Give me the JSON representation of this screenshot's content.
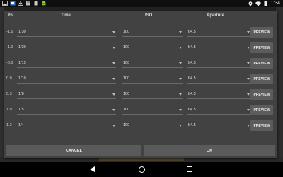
{
  "status_bar": {
    "time": "1:34",
    "left_icons": [
      "image-icon",
      "gallery-icon",
      "download-icon",
      "storage-icon",
      "sd-card-icon",
      "android-icon"
    ],
    "right_icons": [
      "location-icon",
      "wifi-icon",
      "battery-icon"
    ]
  },
  "dialog": {
    "headers": {
      "ev": "Ev",
      "time": "Time",
      "iso": "ISO",
      "aperture": "Aperture"
    },
    "rows": [
      {
        "ev": "-1.6",
        "time": "1/30",
        "iso": "100",
        "aperture": "f/4.5",
        "preview": "PREVIEW"
      },
      {
        "ev": "-1.0",
        "time": "1/20",
        "iso": "100",
        "aperture": "f/4.5",
        "preview": "PREVIEW"
      },
      {
        "ev": "-0.6",
        "time": "1/15",
        "iso": "100",
        "aperture": "f/4.5",
        "preview": "PREVIEW"
      },
      {
        "ev": "0.0",
        "time": "1/10",
        "iso": "100",
        "aperture": "f/4.5",
        "preview": "PREVIEW"
      },
      {
        "ev": "0.3",
        "time": "1/8",
        "iso": "100",
        "aperture": "f/4.5",
        "preview": "PREVIEW"
      },
      {
        "ev": "1.0",
        "time": "1/5",
        "iso": "100",
        "aperture": "f/4.5",
        "preview": "PREVIEW"
      },
      {
        "ev": "1.3",
        "time": "1/4",
        "iso": "100",
        "aperture": "f/4.5",
        "preview": "PREVIEW"
      }
    ],
    "cancel_label": "CANCEL",
    "ok_label": "OK"
  },
  "nav": {
    "icons": [
      "back-icon",
      "home-icon",
      "recents-icon"
    ]
  }
}
